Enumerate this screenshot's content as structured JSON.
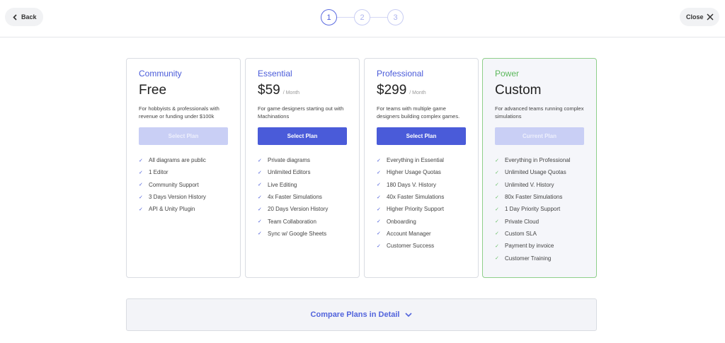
{
  "header": {
    "back_label": "Back",
    "close_label": "Close",
    "steps": [
      "1",
      "2",
      "3"
    ]
  },
  "plans": [
    {
      "name": "Community",
      "price": "Free",
      "period": "",
      "description": "For hobbyists & professionals with revenue or funding under $100k",
      "button_label": "Select Plan",
      "features": [
        "All diagrams are public",
        "1 Editor",
        "Community Support",
        "3 Days Version History",
        "API & Unity Plugin"
      ]
    },
    {
      "name": "Essential",
      "price": "$59",
      "period": "/ Month",
      "description": "For game designers starting out with Machinations",
      "button_label": "Select Plan",
      "features": [
        "Private diagrams",
        "Unlimited Editors",
        "Live Editing",
        "4x Faster Simulations",
        "20 Days Version History",
        "Team Collaboration",
        "Sync w/ Google Sheets"
      ]
    },
    {
      "name": "Professional",
      "price": "$299",
      "period": "/ Month",
      "description": "For teams with multiple game designers building complex games.",
      "button_label": "Select Plan",
      "features": [
        "Everything in Essential",
        "Higher Usage Quotas",
        "180 Days V. History",
        "40x Faster Simulations",
        "Higher Priority Support",
        "Onboarding",
        "Account Manager",
        "Customer Success"
      ]
    },
    {
      "name": "Power",
      "price": "Custom",
      "period": "",
      "description": "For advanced teams running complex simulations",
      "button_label": "Current Plan",
      "features": [
        "Everything in Professional",
        "Unlimited Usage Quotas",
        "Unlimited V. History",
        "80x Faster Simulations",
        "1 Day Priority Support",
        "Private Cloud",
        "Custom SLA",
        "Payment by invoice",
        "Customer Training"
      ]
    }
  ],
  "compare_label": "Compare Plans in Detail",
  "colors": {
    "accent": "#4a5bd9",
    "accent_muted": "#c9cff5",
    "power_green": "#5cb85c"
  }
}
